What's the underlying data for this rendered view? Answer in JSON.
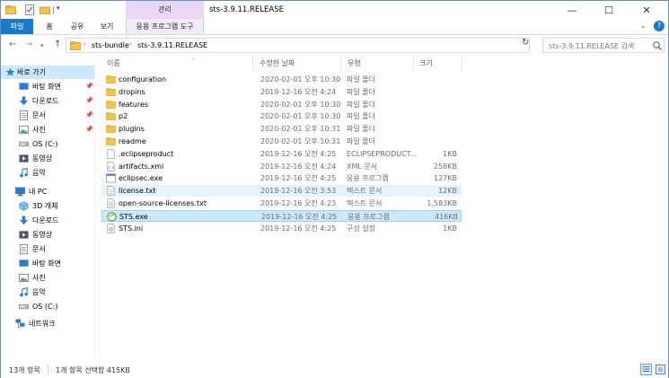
{
  "window": {
    "title": "sts-3.9.11.RELEASE",
    "context_group": "관리",
    "controls": {
      "minimize": "—",
      "maximize": "☐",
      "close": "✕"
    }
  },
  "ribbon": {
    "tabs": [
      {
        "label": "파일",
        "active": true
      },
      {
        "label": "홈"
      },
      {
        "label": "공유"
      },
      {
        "label": "보기"
      },
      {
        "label": "응용 프로그램 도구"
      }
    ],
    "expand_glyph": "⌄",
    "help_glyph": "?"
  },
  "address": {
    "crumbs": [
      "sts-bundle",
      "sts-3.9.11.RELEASE"
    ],
    "separator": "›",
    "search_placeholder": "sts-3.9.11.RELEASE 검색"
  },
  "sidebar": {
    "items": [
      {
        "label": "바로 가기",
        "icon": "star-icon",
        "active": true
      },
      {
        "label": "바탕 화면",
        "icon": "desktop-icon",
        "pinned": true
      },
      {
        "label": "다운로드",
        "icon": "download-icon",
        "pinned": true
      },
      {
        "label": "문서",
        "icon": "document-icon",
        "pinned": true
      },
      {
        "label": "사진",
        "icon": "pictures-icon",
        "pinned": true
      },
      {
        "label": "OS (C:)",
        "icon": "drive-icon"
      },
      {
        "label": "동영상",
        "icon": "video-icon"
      },
      {
        "label": "음악",
        "icon": "music-icon"
      },
      {
        "label": "내 PC",
        "icon": "pc-icon"
      },
      {
        "label": "3D 개체",
        "icon": "3d-objects-icon"
      },
      {
        "label": "다운로드",
        "icon": "download-icon"
      },
      {
        "label": "동영상",
        "icon": "video-icon"
      },
      {
        "label": "문서",
        "icon": "document-icon"
      },
      {
        "label": "바탕 화면",
        "icon": "desktop-icon"
      },
      {
        "label": "사진",
        "icon": "pictures-icon"
      },
      {
        "label": "음악",
        "icon": "music-icon"
      },
      {
        "label": "OS (C:)",
        "icon": "drive-icon"
      },
      {
        "label": "네트워크",
        "icon": "network-icon"
      }
    ]
  },
  "list": {
    "columns": {
      "name": "이름",
      "date": "수정한 날짜",
      "type": "유형",
      "size": "크기"
    },
    "files": [
      {
        "name": "configuration",
        "date": "2020-02-01 오후 10:30",
        "type": "파일 폴더",
        "size": "",
        "icon": "folder-icon"
      },
      {
        "name": "dropins",
        "date": "2019-12-16 오전 4:24",
        "type": "파일 폴더",
        "size": "",
        "icon": "folder-icon"
      },
      {
        "name": "features",
        "date": "2020-02-01 오후 10:30",
        "type": "파일 폴더",
        "size": "",
        "icon": "folder-icon"
      },
      {
        "name": "p2",
        "date": "2020-02-01 오후 10:30",
        "type": "파일 폴더",
        "size": "",
        "icon": "folder-icon"
      },
      {
        "name": "plugins",
        "date": "2020-02-01 오후 10:31",
        "type": "파일 폴더",
        "size": "",
        "icon": "folder-icon"
      },
      {
        "name": "readme",
        "date": "2020-02-01 오후 10:31",
        "type": "파일 폴더",
        "size": "",
        "icon": "folder-icon"
      },
      {
        "name": ".eclipseproduct",
        "date": "2019-12-16 오전 4:25",
        "type": "ECLIPSEPRODUCT...",
        "size": "1KB",
        "icon": "file-icon"
      },
      {
        "name": "artifacts.xml",
        "date": "2019-12-16 오전 4:24",
        "type": "XML 문서",
        "size": "258KB",
        "icon": "xml-file-icon"
      },
      {
        "name": "eclipsec.exe",
        "date": "2019-12-16 오전 4:25",
        "type": "응용 프로그램",
        "size": "127KB",
        "icon": "exe-icon"
      },
      {
        "name": "license.txt",
        "date": "2019-12-16 오전 3:53",
        "type": "텍스트 문서",
        "size": "12KB",
        "icon": "text-file-icon",
        "state": "hover"
      },
      {
        "name": "open-source-licenses.txt",
        "date": "2019-12-16 오전 4:23",
        "type": "텍스트 문서",
        "size": "1,583KB",
        "icon": "text-file-icon"
      },
      {
        "name": "STS.exe",
        "date": "2019-12-16 오전 4:25",
        "type": "응용 프로그램",
        "size": "416KB",
        "icon": "sts-app-icon",
        "state": "selected"
      },
      {
        "name": "STS.ini",
        "date": "2019-12-16 오전 4:25",
        "type": "구성 설정",
        "size": "1KB",
        "icon": "ini-file-icon"
      }
    ]
  },
  "status": {
    "count": "13개 항목",
    "selection": "1개 항목 선택함 415KB"
  },
  "colors": {
    "accent": "#1979ca",
    "selection": "#cce8ff",
    "hover": "#e5f3ff",
    "context_tab": "#e9d7f5",
    "folder": "#f6c445"
  }
}
